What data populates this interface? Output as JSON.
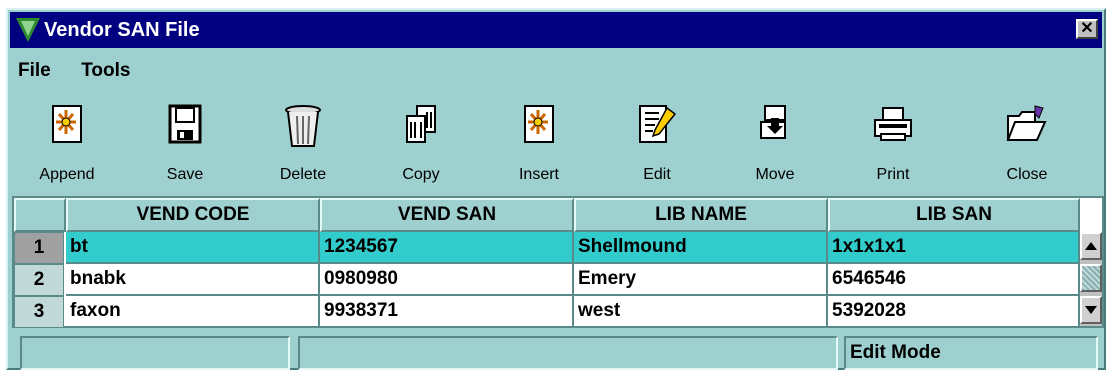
{
  "window": {
    "title": "Vendor SAN File",
    "close_glyph": "✕"
  },
  "menu": [
    {
      "label": "File"
    },
    {
      "label": "Tools"
    }
  ],
  "toolbar": [
    {
      "label": "Append",
      "icon": "append-icon"
    },
    {
      "label": "Save",
      "icon": "save-icon"
    },
    {
      "label": "Delete",
      "icon": "delete-icon"
    },
    {
      "label": "Copy",
      "icon": "copy-icon"
    },
    {
      "label": "Insert",
      "icon": "insert-icon"
    },
    {
      "label": "Edit",
      "icon": "edit-icon"
    },
    {
      "label": "Move",
      "icon": "move-icon"
    },
    {
      "label": "Print",
      "icon": "print-icon"
    },
    {
      "label": "Close",
      "icon": "close-folder-icon"
    }
  ],
  "table": {
    "columns": [
      "VEND CODE",
      "VEND SAN",
      "LIB NAME",
      "LIB SAN"
    ],
    "rows": [
      {
        "num": "1",
        "vend_code": "bt",
        "vend_san": "1234567",
        "lib_name": "Shellmound",
        "lib_san": "1x1x1x1",
        "selected": true
      },
      {
        "num": "2",
        "vend_code": "bnabk",
        "vend_san": "0980980",
        "lib_name": "Emery",
        "lib_san": "6546546",
        "selected": false
      },
      {
        "num": "3",
        "vend_code": "faxon",
        "vend_san": "9938371",
        "lib_name": "west",
        "lib_san": "5392028",
        "selected": false
      }
    ]
  },
  "status": {
    "field1": "",
    "field2": "",
    "mode": "Edit Mode"
  },
  "colors": {
    "title_bg": "#000080",
    "window_bg": "#9fd0d0",
    "selected_row": "#33cccc"
  }
}
